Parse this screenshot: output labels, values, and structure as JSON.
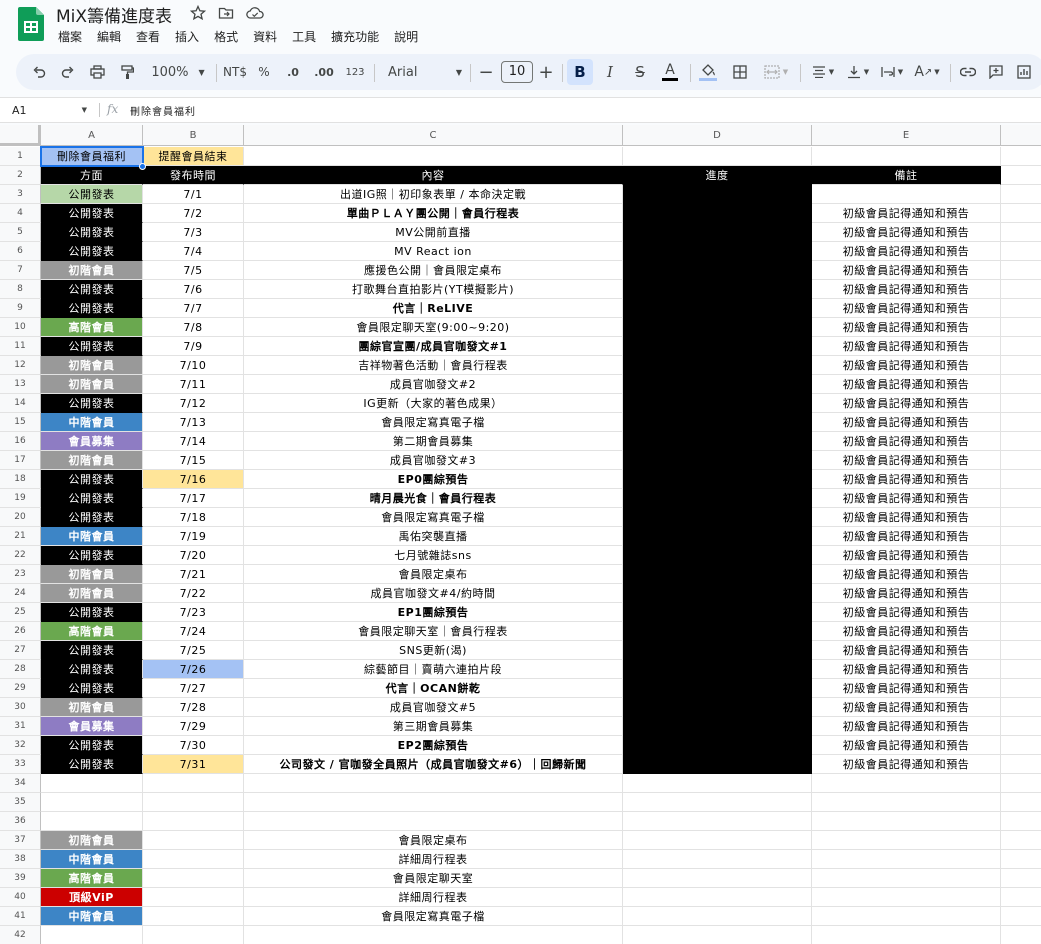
{
  "app": {
    "title": "MiX籌備進度表",
    "menus": [
      "檔案",
      "編輯",
      "查看",
      "插入",
      "格式",
      "資料",
      "工具",
      "擴充功能",
      "說明"
    ]
  },
  "toolbar": {
    "zoom": "100%",
    "currency": "NT$",
    "percent": "%",
    "dec_decrease": ".0",
    "dec_increase": ".00",
    "format_123": "123",
    "font": "Arial",
    "font_size": "10",
    "bold": "B",
    "italic": "I",
    "strike": "S",
    "text_color": "A"
  },
  "formula_bar": {
    "cell_ref": "A1",
    "fx": "fx",
    "content": "刪除會員福利"
  },
  "colors": {
    "black": "#000000",
    "public_green_light": "#b6d7a8",
    "gray": "#999999",
    "green": "#6aa84f",
    "blue": "#3d85c6",
    "purple": "#8e7cc3",
    "red": "#cc0000",
    "light_blue": "#a4c2f4",
    "light_yellow": "#ffe599"
  },
  "columns": [
    "A",
    "B",
    "C",
    "D",
    "E"
  ],
  "rows": [
    {
      "n": "1",
      "a": "刪除會員福利",
      "b": "提醒會員結束",
      "c": "",
      "d": "",
      "e": "",
      "aBg": "#a4c2f4",
      "aFg": "#000000",
      "bBg": "#ffe599",
      "bFg": "#000000",
      "hdr": false
    },
    {
      "n": "2",
      "a": "方面",
      "b": "發布時間",
      "c": "內容",
      "d": "進度",
      "e": "備註",
      "hdr": true
    },
    {
      "n": "3",
      "a": "公開發表",
      "b": "7/1",
      "c": "出道IG照｜初印象表單 / 本命決定戰",
      "d": "",
      "e": "",
      "aBg": "#b6d7a8",
      "aFg": "#000000",
      "cBold": false
    },
    {
      "n": "4",
      "a": "公開發表",
      "b": "7/2",
      "c": "單曲ＰＬＡＹ團公開｜會員行程表",
      "d": "",
      "e": "初級會員記得通知和預告",
      "aBg": "#000000",
      "aFg": "#ffffff",
      "cBold": true
    },
    {
      "n": "5",
      "a": "公開發表",
      "b": "7/3",
      "c": "MV公開前直播",
      "d": "",
      "e": "初級會員記得通知和預告",
      "aBg": "#000000",
      "aFg": "#ffffff",
      "cBold": false
    },
    {
      "n": "6",
      "a": "公開發表",
      "b": "7/4",
      "c": "MV React ion",
      "d": "",
      "e": "初級會員記得通知和預告",
      "aBg": "#000000",
      "aFg": "#ffffff",
      "cBold": false
    },
    {
      "n": "7",
      "a": "初階會員",
      "b": "7/5",
      "c": "應援色公開｜會員限定桌布",
      "d": "",
      "e": "初級會員記得通知和預告",
      "aBg": "#999999",
      "aFg": "#ffffff",
      "cBold": false
    },
    {
      "n": "8",
      "a": "公開發表",
      "b": "7/6",
      "c": "打歌舞台直拍影片(YT模擬影片)",
      "d": "",
      "e": "初級會員記得通知和預告",
      "aBg": "#000000",
      "aFg": "#ffffff",
      "cBold": false
    },
    {
      "n": "9",
      "a": "公開發表",
      "b": "7/7",
      "c": "代言｜ReLIVE",
      "d": "",
      "e": "初級會員記得通知和預告",
      "aBg": "#000000",
      "aFg": "#ffffff",
      "cBold": true
    },
    {
      "n": "10",
      "a": "高階會員",
      "b": "7/8",
      "c": "會員限定聊天室(9:00~9:20)",
      "d": "",
      "e": "初級會員記得通知和預告",
      "aBg": "#6aa84f",
      "aFg": "#ffffff",
      "cBold": false
    },
    {
      "n": "11",
      "a": "公開發表",
      "b": "7/9",
      "c": "團綜官宣團/成員官咖發文#1",
      "d": "",
      "e": "初級會員記得通知和預告",
      "aBg": "#000000",
      "aFg": "#ffffff",
      "cBold": true
    },
    {
      "n": "12",
      "a": "初階會員",
      "b": "7/10",
      "c": "吉祥物著色活動｜會員行程表",
      "d": "",
      "e": "初級會員記得通知和預告",
      "aBg": "#999999",
      "aFg": "#ffffff",
      "cBold": false
    },
    {
      "n": "13",
      "a": "初階會員",
      "b": "7/11",
      "c": "成員官咖發文#2",
      "d": "",
      "e": "初級會員記得通知和預告",
      "aBg": "#999999",
      "aFg": "#ffffff",
      "cBold": false
    },
    {
      "n": "14",
      "a": "公開發表",
      "b": "7/12",
      "c": "IG更新（大家的著色成果）",
      "d": "",
      "e": "初級會員記得通知和預告",
      "aBg": "#000000",
      "aFg": "#ffffff",
      "cBold": false
    },
    {
      "n": "15",
      "a": "中階會員",
      "b": "7/13",
      "c": "會員限定寫真電子檔",
      "d": "",
      "e": "初級會員記得通知和預告",
      "aBg": "#3d85c6",
      "aFg": "#ffffff",
      "cBold": false
    },
    {
      "n": "16",
      "a": "會員募集",
      "b": "7/14",
      "c": "第二期會員募集",
      "d": "",
      "e": "初級會員記得通知和預告",
      "aBg": "#8e7cc3",
      "aFg": "#ffffff",
      "cBold": false
    },
    {
      "n": "17",
      "a": "初階會員",
      "b": "7/15",
      "c": "成員官咖發文#3",
      "d": "",
      "e": "初級會員記得通知和預告",
      "aBg": "#999999",
      "aFg": "#ffffff",
      "cBold": false
    },
    {
      "n": "18",
      "a": "公開發表",
      "b": "7/16",
      "c": "EP0團綜預告",
      "d": "",
      "e": "初級會員記得通知和預告",
      "aBg": "#000000",
      "aFg": "#ffffff",
      "bBg": "#ffe599",
      "cBold": true
    },
    {
      "n": "19",
      "a": "公開發表",
      "b": "7/17",
      "c": "晴月晨光食｜會員行程表",
      "d": "",
      "e": "初級會員記得通知和預告",
      "aBg": "#000000",
      "aFg": "#ffffff",
      "cBold": true
    },
    {
      "n": "20",
      "a": "公開發表",
      "b": "7/18",
      "c": "會員限定寫真電子檔",
      "d": "",
      "e": "初級會員記得通知和預告",
      "aBg": "#000000",
      "aFg": "#ffffff",
      "cBold": false
    },
    {
      "n": "21",
      "a": "中階會員",
      "b": "7/19",
      "c": "禹佑突襲直播",
      "d": "",
      "e": "初級會員記得通知和預告",
      "aBg": "#3d85c6",
      "aFg": "#ffffff",
      "cBold": false
    },
    {
      "n": "22",
      "a": "公開發表",
      "b": "7/20",
      "c": "七月號雜誌sns",
      "d": "",
      "e": "初級會員記得通知和預告",
      "aBg": "#000000",
      "aFg": "#ffffff",
      "cBold": false
    },
    {
      "n": "23",
      "a": "初階會員",
      "b": "7/21",
      "c": "會員限定桌布",
      "d": "",
      "e": "初級會員記得通知和預告",
      "aBg": "#999999",
      "aFg": "#ffffff",
      "cBold": false
    },
    {
      "n": "24",
      "a": "初階會員",
      "b": "7/22",
      "c": "成員官咖發文#4/約時間",
      "d": "",
      "e": "初級會員記得通知和預告",
      "aBg": "#999999",
      "aFg": "#ffffff",
      "cBold": false
    },
    {
      "n": "25",
      "a": "公開發表",
      "b": "7/23",
      "c": "EP1團綜預告",
      "d": "",
      "e": "初級會員記得通知和預告",
      "aBg": "#000000",
      "aFg": "#ffffff",
      "cBold": true
    },
    {
      "n": "26",
      "a": "高階會員",
      "b": "7/24",
      "c": "會員限定聊天室｜會員行程表",
      "d": "",
      "e": "初級會員記得通知和預告",
      "aBg": "#6aa84f",
      "aFg": "#ffffff",
      "cBold": false
    },
    {
      "n": "27",
      "a": "公開發表",
      "b": "7/25",
      "c": "SNS更新(渴)",
      "d": "",
      "e": "初級會員記得通知和預告",
      "aBg": "#000000",
      "aFg": "#ffffff",
      "cBold": false
    },
    {
      "n": "28",
      "a": "公開發表",
      "b": "7/26",
      "c": "綜藝節目｜賣萌六連拍片段",
      "d": "",
      "e": "初級會員記得通知和預告",
      "aBg": "#000000",
      "aFg": "#ffffff",
      "bBg": "#a4c2f4",
      "cBold": false
    },
    {
      "n": "29",
      "a": "公開發表",
      "b": "7/27",
      "c": "代言｜OCAN餅乾",
      "d": "",
      "e": "初級會員記得通知和預告",
      "aBg": "#000000",
      "aFg": "#ffffff",
      "cBold": true
    },
    {
      "n": "30",
      "a": "初階會員",
      "b": "7/28",
      "c": "成員官咖發文#5",
      "d": "",
      "e": "初級會員記得通知和預告",
      "aBg": "#999999",
      "aFg": "#ffffff",
      "cBold": false
    },
    {
      "n": "31",
      "a": "會員募集",
      "b": "7/29",
      "c": "第三期會員募集",
      "d": "",
      "e": "初級會員記得通知和預告",
      "aBg": "#8e7cc3",
      "aFg": "#ffffff",
      "cBold": false
    },
    {
      "n": "32",
      "a": "公開發表",
      "b": "7/30",
      "c": "EP2團綜預告",
      "d": "",
      "e": "初級會員記得通知和預告",
      "aBg": "#000000",
      "aFg": "#ffffff",
      "cBold": true
    },
    {
      "n": "33",
      "a": "公開發表",
      "b": "7/31",
      "c": "公司發文 / 官咖發全員照片（成員官咖發文#6）｜回歸新聞",
      "d": "",
      "e": "初級會員記得通知和預告",
      "aBg": "#000000",
      "aFg": "#ffffff",
      "bBg": "#ffe599",
      "cBold": true
    },
    {
      "n": "34",
      "a": "",
      "b": "",
      "c": "",
      "d": "",
      "e": ""
    },
    {
      "n": "35",
      "a": "",
      "b": "",
      "c": "",
      "d": "",
      "e": ""
    },
    {
      "n": "36",
      "a": "",
      "b": "",
      "c": "",
      "d": "",
      "e": ""
    },
    {
      "n": "37",
      "a": "初階會員",
      "b": "",
      "c": "會員限定桌布",
      "d": "",
      "e": "",
      "aBg": "#999999",
      "aFg": "#ffffff"
    },
    {
      "n": "38",
      "a": "中階會員",
      "b": "",
      "c": "詳細周行程表",
      "d": "",
      "e": "",
      "aBg": "#3d85c6",
      "aFg": "#ffffff"
    },
    {
      "n": "39",
      "a": "高階會員",
      "b": "",
      "c": "會員限定聊天室",
      "d": "",
      "e": "",
      "aBg": "#6aa84f",
      "aFg": "#ffffff"
    },
    {
      "n": "40",
      "a": "頂級ViP",
      "b": "",
      "c": "詳細周行程表",
      "d": "",
      "e": "",
      "aBg": "#cc0000",
      "aFg": "#ffffff"
    },
    {
      "n": "41",
      "a": "中階會員",
      "b": "",
      "c": "會員限定寫真電子檔",
      "d": "",
      "e": "",
      "aBg": "#3d85c6",
      "aFg": "#ffffff"
    },
    {
      "n": "42",
      "a": "",
      "b": "",
      "c": "",
      "d": "",
      "e": ""
    }
  ]
}
